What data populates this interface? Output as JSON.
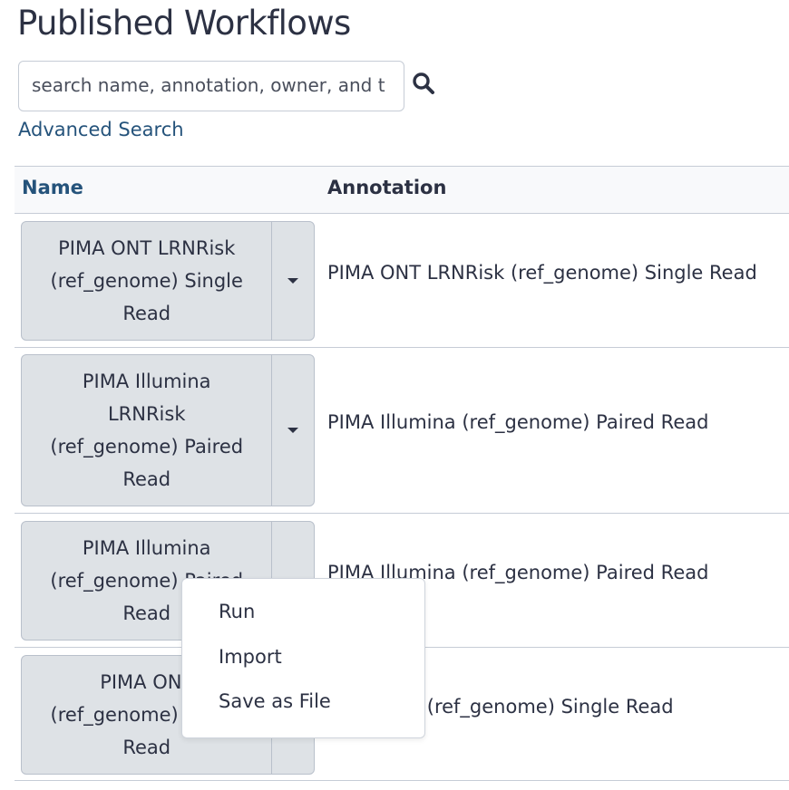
{
  "page": {
    "title": "Published Workflows"
  },
  "search": {
    "placeholder": "search name, annotation, owner, and tags",
    "advanced_label": "Advanced Search",
    "icon": "search-icon"
  },
  "table": {
    "headers": {
      "name": "Name",
      "annotation": "Annotation"
    },
    "rows": [
      {
        "name_lines": [
          "PIMA ONT LRNRisk",
          "(ref_genome) Single",
          "Read"
        ],
        "annotation": "PIMA ONT LRNRisk (ref_genome) Single Read"
      },
      {
        "name_lines": [
          "PIMA Illumina",
          "LRNRisk",
          "(ref_genome) Paired",
          "Read"
        ],
        "annotation": "PIMA Illumina (ref_genome) Paired Read"
      },
      {
        "name_lines": [
          "PIMA Illumina",
          "(ref_genome) Paired",
          "Read"
        ],
        "annotation": "PIMA Illumina (ref_genome) Paired Read"
      },
      {
        "name_lines": [
          "PIMA ONT",
          "(ref_genome) Single",
          "Read"
        ],
        "annotation": "PIMA ONT (ref_genome) Single Read"
      }
    ]
  },
  "dropdown_menu": {
    "items": [
      "Run",
      "Import",
      "Save as File"
    ]
  },
  "colors": {
    "link": "#25537b",
    "button_bg": "#dee2e6",
    "border": "#c6ccd6",
    "text": "#2c3143"
  }
}
